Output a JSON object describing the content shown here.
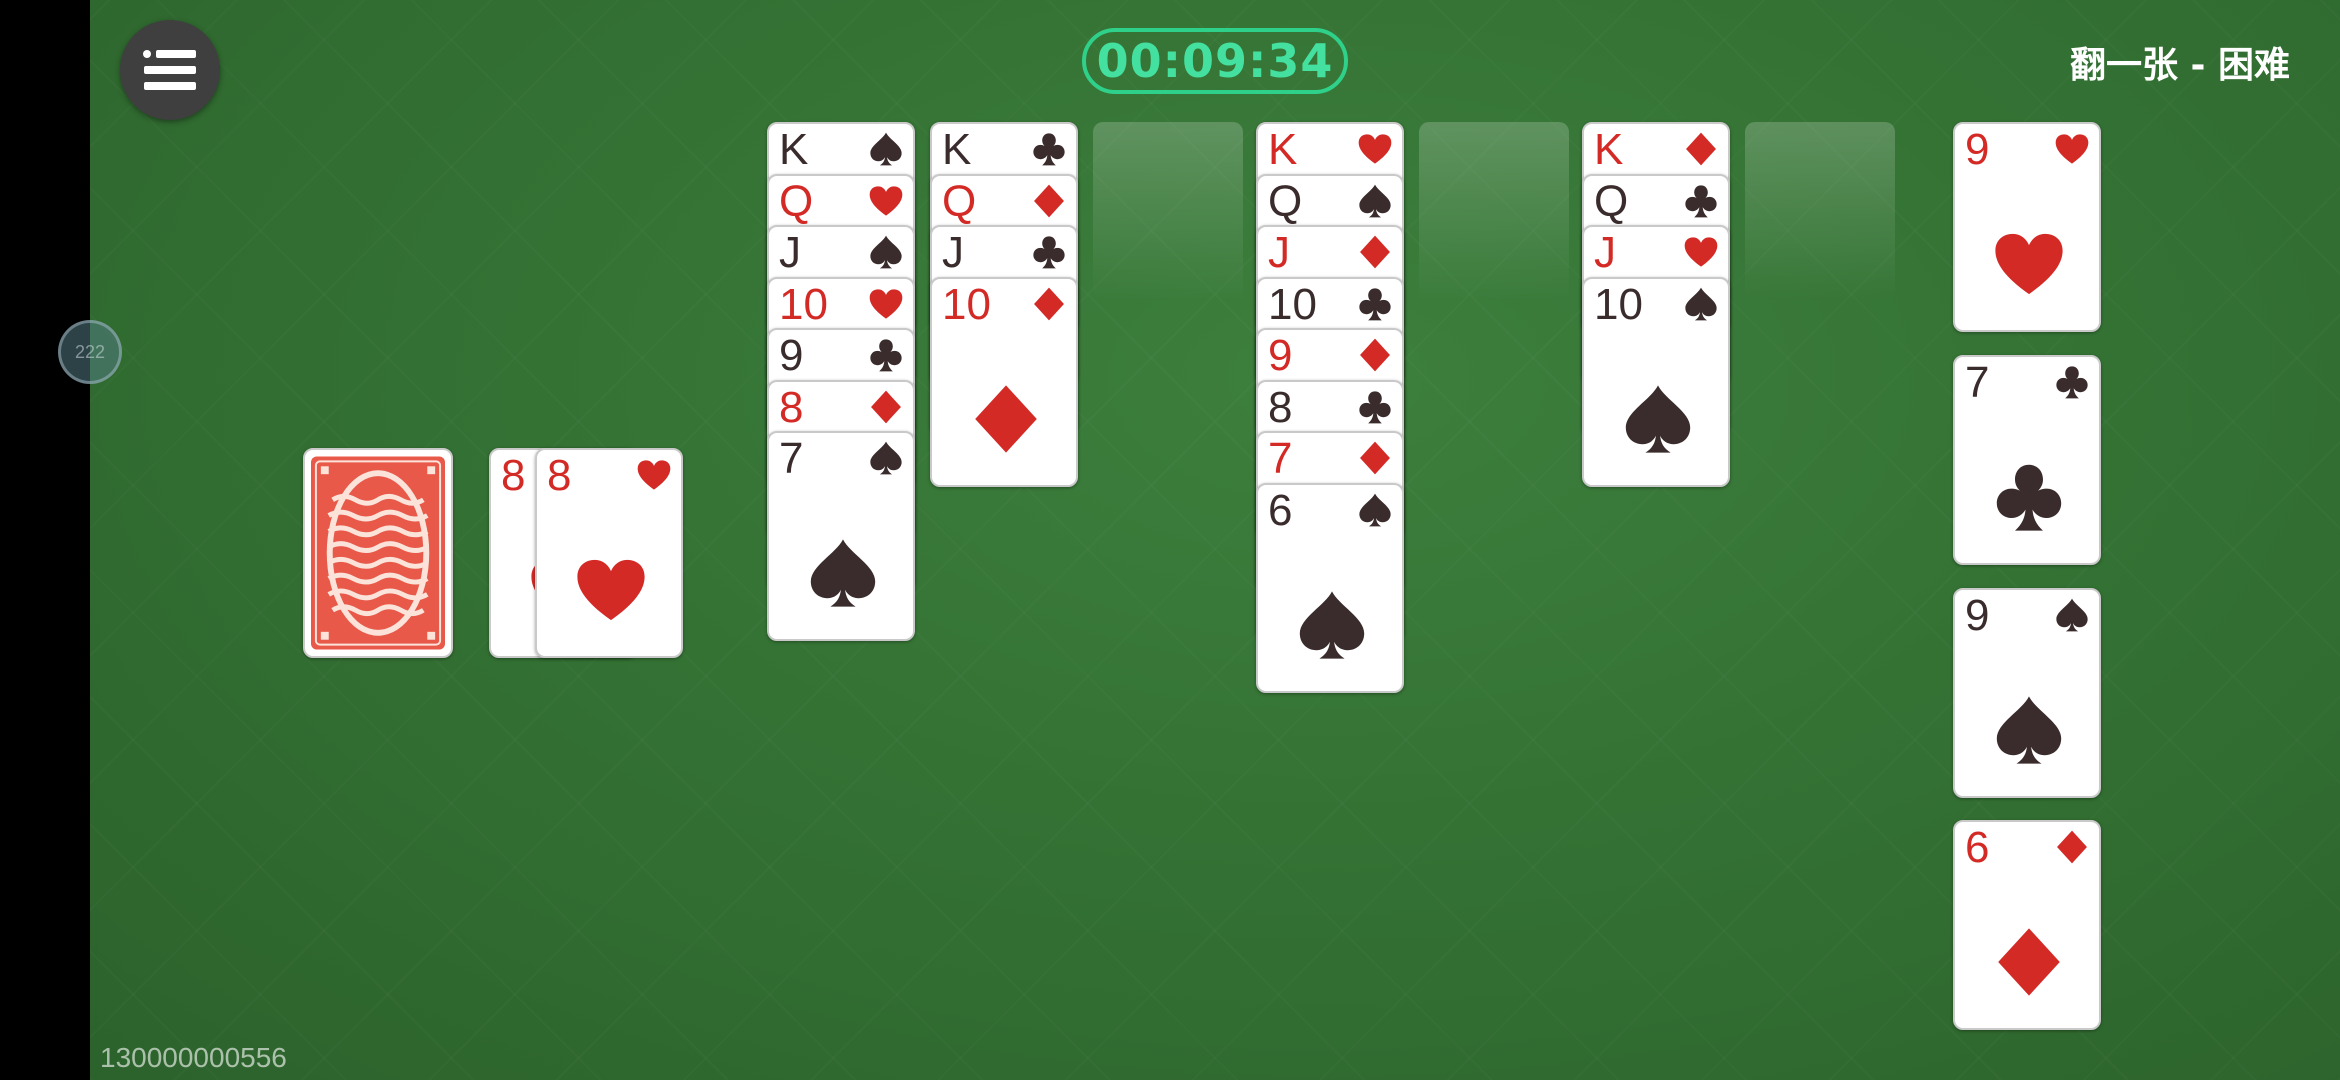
{
  "header": {
    "timer": "00:09:34",
    "mode": "翻一张 - 困难",
    "game_id": "130000000556"
  },
  "side_bubble": "222",
  "colors": {
    "felt": "#347234",
    "timer": "#2fd08a",
    "red_suit": "#d42a26",
    "black_suit": "#3a2c2c"
  },
  "stock": {
    "face_down": true
  },
  "waste": [
    {
      "rank": "8",
      "suit": "hearts"
    },
    {
      "rank": "8",
      "suit": "hearts"
    }
  ],
  "tableau": [
    [
      {
        "rank": "K",
        "suit": "spades"
      },
      {
        "rank": "Q",
        "suit": "hearts"
      },
      {
        "rank": "J",
        "suit": "spades"
      },
      {
        "rank": "10",
        "suit": "hearts"
      },
      {
        "rank": "9",
        "suit": "clubs"
      },
      {
        "rank": "8",
        "suit": "diamonds"
      },
      {
        "rank": "7",
        "suit": "spades"
      }
    ],
    [
      {
        "rank": "K",
        "suit": "clubs"
      },
      {
        "rank": "Q",
        "suit": "diamonds"
      },
      {
        "rank": "J",
        "suit": "clubs"
      },
      {
        "rank": "10",
        "suit": "diamonds"
      }
    ],
    [],
    [
      {
        "rank": "K",
        "suit": "hearts"
      },
      {
        "rank": "Q",
        "suit": "spades"
      },
      {
        "rank": "J",
        "suit": "diamonds"
      },
      {
        "rank": "10",
        "suit": "clubs"
      },
      {
        "rank": "9",
        "suit": "diamonds"
      },
      {
        "rank": "8",
        "suit": "clubs"
      },
      {
        "rank": "7",
        "suit": "diamonds"
      },
      {
        "rank": "6",
        "suit": "spades"
      }
    ],
    [],
    [
      {
        "rank": "K",
        "suit": "diamonds"
      },
      {
        "rank": "Q",
        "suit": "clubs"
      },
      {
        "rank": "J",
        "suit": "hearts"
      },
      {
        "rank": "10",
        "suit": "spades"
      }
    ],
    []
  ],
  "foundations": [
    {
      "rank": "9",
      "suit": "hearts"
    },
    {
      "rank": "7",
      "suit": "clubs"
    },
    {
      "rank": "9",
      "suit": "spades"
    },
    {
      "rank": "6",
      "suit": "diamonds"
    }
  ]
}
